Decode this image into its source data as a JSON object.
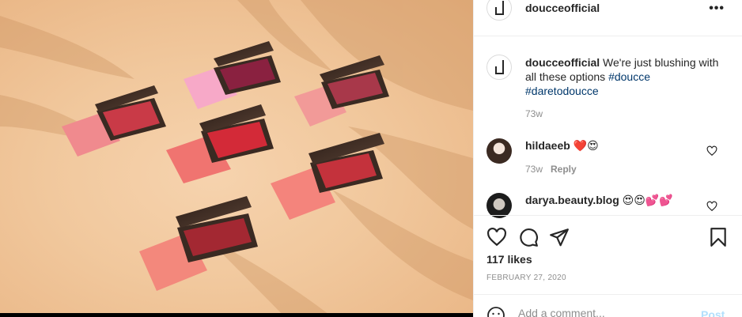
{
  "post": {
    "username": "doucceofficial",
    "more_label": "•••"
  },
  "caption": {
    "username": "doucceofficial",
    "text": " We're just blushing with all these options ",
    "hashtag1": "#doucce",
    "hashtag2": "#daretodoucce",
    "time": "73w"
  },
  "comments": [
    {
      "username": "hildaeeb",
      "text": " ❤️😍",
      "time": "73w",
      "reply_label": "Reply"
    },
    {
      "username": "darya.beauty.blog",
      "text": " 😍😍💕💕"
    }
  ],
  "likes": "117 likes",
  "date": "FEBRUARY 27, 2020",
  "add_comment": {
    "placeholder": "Add a comment...",
    "post_label": "Post"
  },
  "colors": {
    "hashtag": "#00376b",
    "muted": "#8e8e8e",
    "post_disabled": "#b2dffc",
    "backdrop": "#f1c89d"
  },
  "icons": [
    "logo-icon",
    "more-icon",
    "heart-icon",
    "comment-icon",
    "share-icon",
    "bookmark-icon",
    "emoji-icon"
  ]
}
